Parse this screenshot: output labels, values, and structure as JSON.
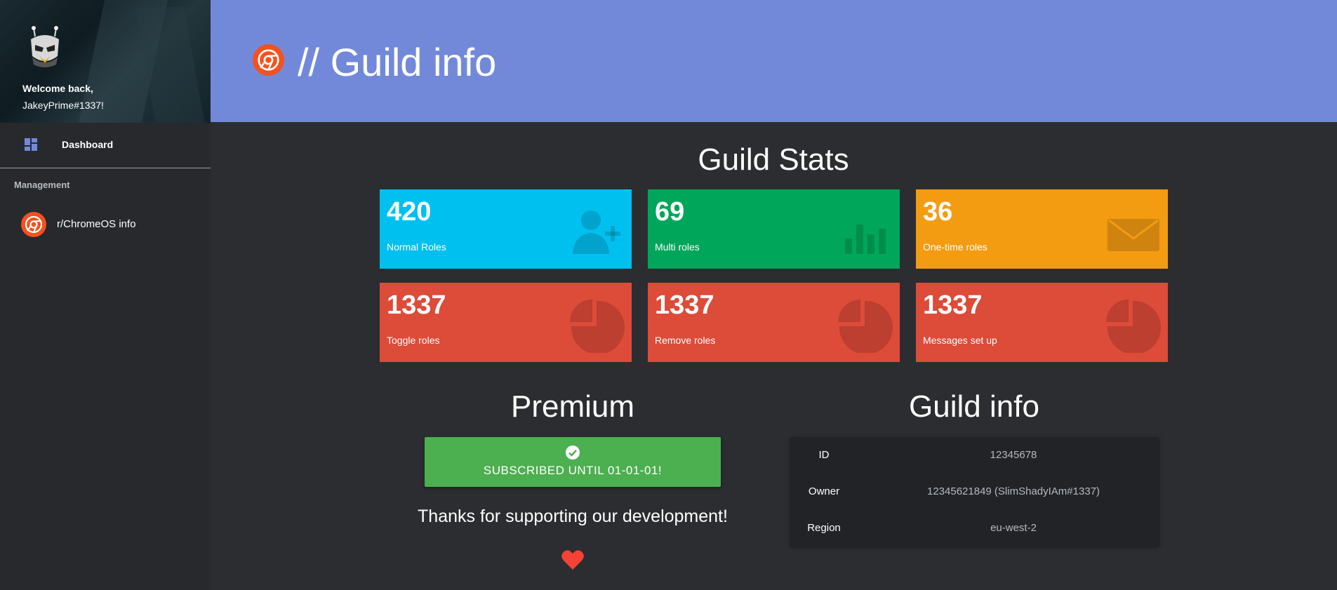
{
  "sidebar": {
    "welcome_line1": "Welcome back,",
    "welcome_line2": "JakeyPrime#1337!",
    "dashboard_label": "Dashboard",
    "section_title": "Management",
    "guild_item_label": "r/ChromeOS info",
    "accent": "#7289da"
  },
  "banner": {
    "title": "// Guild info",
    "background": "#7289da"
  },
  "stats": {
    "heading": "Guild Stats",
    "cards": [
      {
        "value": "420",
        "label": "Normal Roles",
        "color": "#00c0ef",
        "icon": "user-plus-icon"
      },
      {
        "value": "69",
        "label": "Multi roles",
        "color": "#00a65a",
        "icon": "bar-chart-icon"
      },
      {
        "value": "36",
        "label": "One-time roles",
        "color": "#f39c12",
        "icon": "envelope-icon"
      },
      {
        "value": "1337",
        "label": "Toggle roles",
        "color": "#dd4b39",
        "icon": "pie-chart-icon"
      },
      {
        "value": "1337",
        "label": "Remove roles",
        "color": "#dd4b39",
        "icon": "pie-chart-icon"
      },
      {
        "value": "1337",
        "label": "Messages set up",
        "color": "#dd4b39",
        "icon": "pie-chart-icon"
      }
    ]
  },
  "premium": {
    "heading": "Premium",
    "status": "SUBSCRIBED UNTIL 01-01-01!",
    "thanks": "Thanks for supporting our development!",
    "status_color": "#4caf50",
    "heart_color": "#f44336"
  },
  "guild_info": {
    "heading": "Guild info",
    "rows": [
      {
        "key": "ID",
        "value": "12345678"
      },
      {
        "key": "Owner",
        "value": "12345621849 (SlimShadyIAm#1337)"
      },
      {
        "key": "Region",
        "value": "eu-west-2"
      }
    ]
  }
}
